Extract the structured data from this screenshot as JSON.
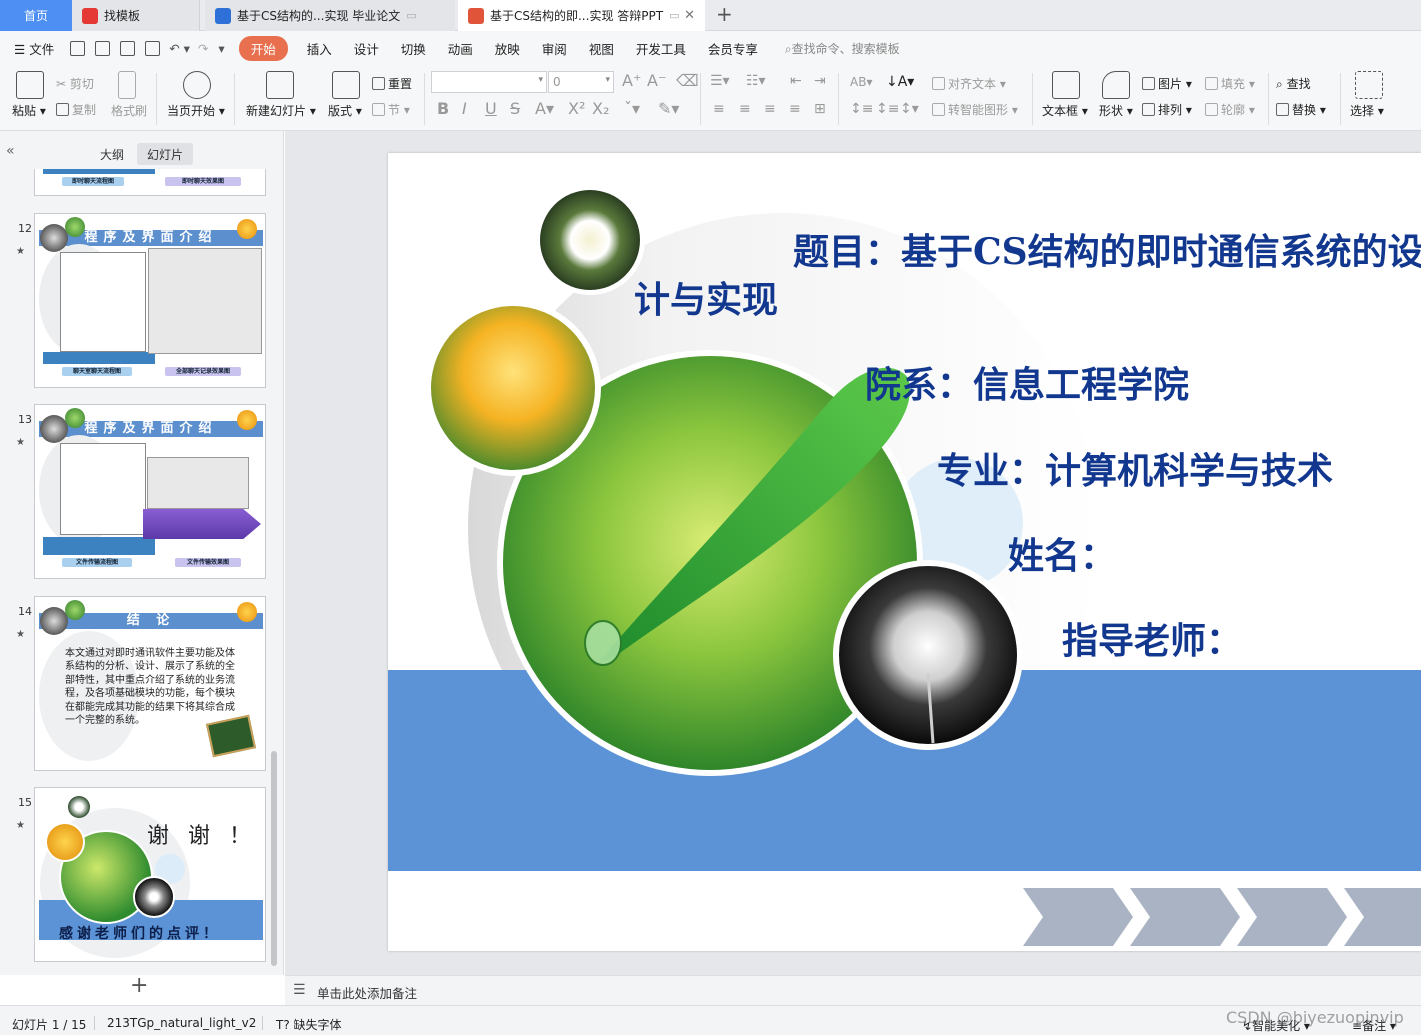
{
  "tabs": {
    "home": "首页",
    "templates": "找模板",
    "doc": "基于CS结构的...实现 毕业论文",
    "ppt": "基于CS结构的即...实现 答辩PPT",
    "new_tab": "+"
  },
  "menu": {
    "file": "文件",
    "items": [
      "开始",
      "插入",
      "设计",
      "切换",
      "动画",
      "放映",
      "审阅",
      "视图",
      "开发工具",
      "会员专享"
    ],
    "search_placeholder": "查找命令、搜索模板"
  },
  "ribbon": {
    "paste": "粘贴",
    "cut": "剪切",
    "copy": "复制",
    "format_painter": "格式刷",
    "from_current": "当页开始",
    "new_slide": "新建幻灯片",
    "layout": "版式",
    "reset": "重置",
    "section": "节",
    "font_size": "0",
    "align_text": "对齐文本",
    "smart_art": "转智能图形",
    "textbox": "文本框",
    "shape": "形状",
    "picture": "图片",
    "arrange": "排列",
    "fill": "填充",
    "outline": "轮廓",
    "find": "查找",
    "replace": "替换",
    "select": "选择"
  },
  "left_panel": {
    "tab_outline": "大纲",
    "tab_slides": "幻灯片",
    "slides": [
      {
        "num": "12",
        "heading": "程序及界面介绍",
        "cap_left": "聊天室聊天流程图",
        "cap_right": "全部聊天记录效果图"
      },
      {
        "num": "13",
        "heading": "程序及界面介绍",
        "cap_left": "文件传输流程图",
        "cap_right": "文件传输效果图"
      },
      {
        "num": "14",
        "heading": "结 论",
        "body": "本文通过对即时通讯软件主要功能及体系结构的分析、设计、展示了系统的全部特性，其中重点介绍了系统的业务流程，及各项基础模块的功能，每个模块在都能完成其功能的结果下将其综合成一个完整的系统。"
      },
      {
        "num": "15",
        "title": "谢 谢 ！",
        "subtitle": "感谢老师们的点评！"
      }
    ],
    "top_caps": [
      "即时聊天流程图",
      "即时聊天效果图"
    ],
    "add_slide": "+"
  },
  "slide": {
    "title_line1": "题目：基于CS结构的即时通信系统的设",
    "title_line2": "计与实现",
    "department": "院系：信息工程学院",
    "major": "专业：计算机科学与技术",
    "name": "姓名：",
    "advisor": "指导老师："
  },
  "notes_placeholder": "单击此处添加备注",
  "status": {
    "slide_counter": "幻灯片 1 / 15",
    "theme": "213TGp_natural_light_v2",
    "missing_font": "缺失字体",
    "smart_beautify": "智能美化",
    "notes": "备注",
    "watermark": "CSDN @biyezuopinvip"
  },
  "colors": {
    "accent": "#e8704f",
    "home_tab": "#4d8ff2",
    "slide_text": "#12378f",
    "slide_band": "#5b93d6",
    "chevron": "#a9b3c4"
  }
}
